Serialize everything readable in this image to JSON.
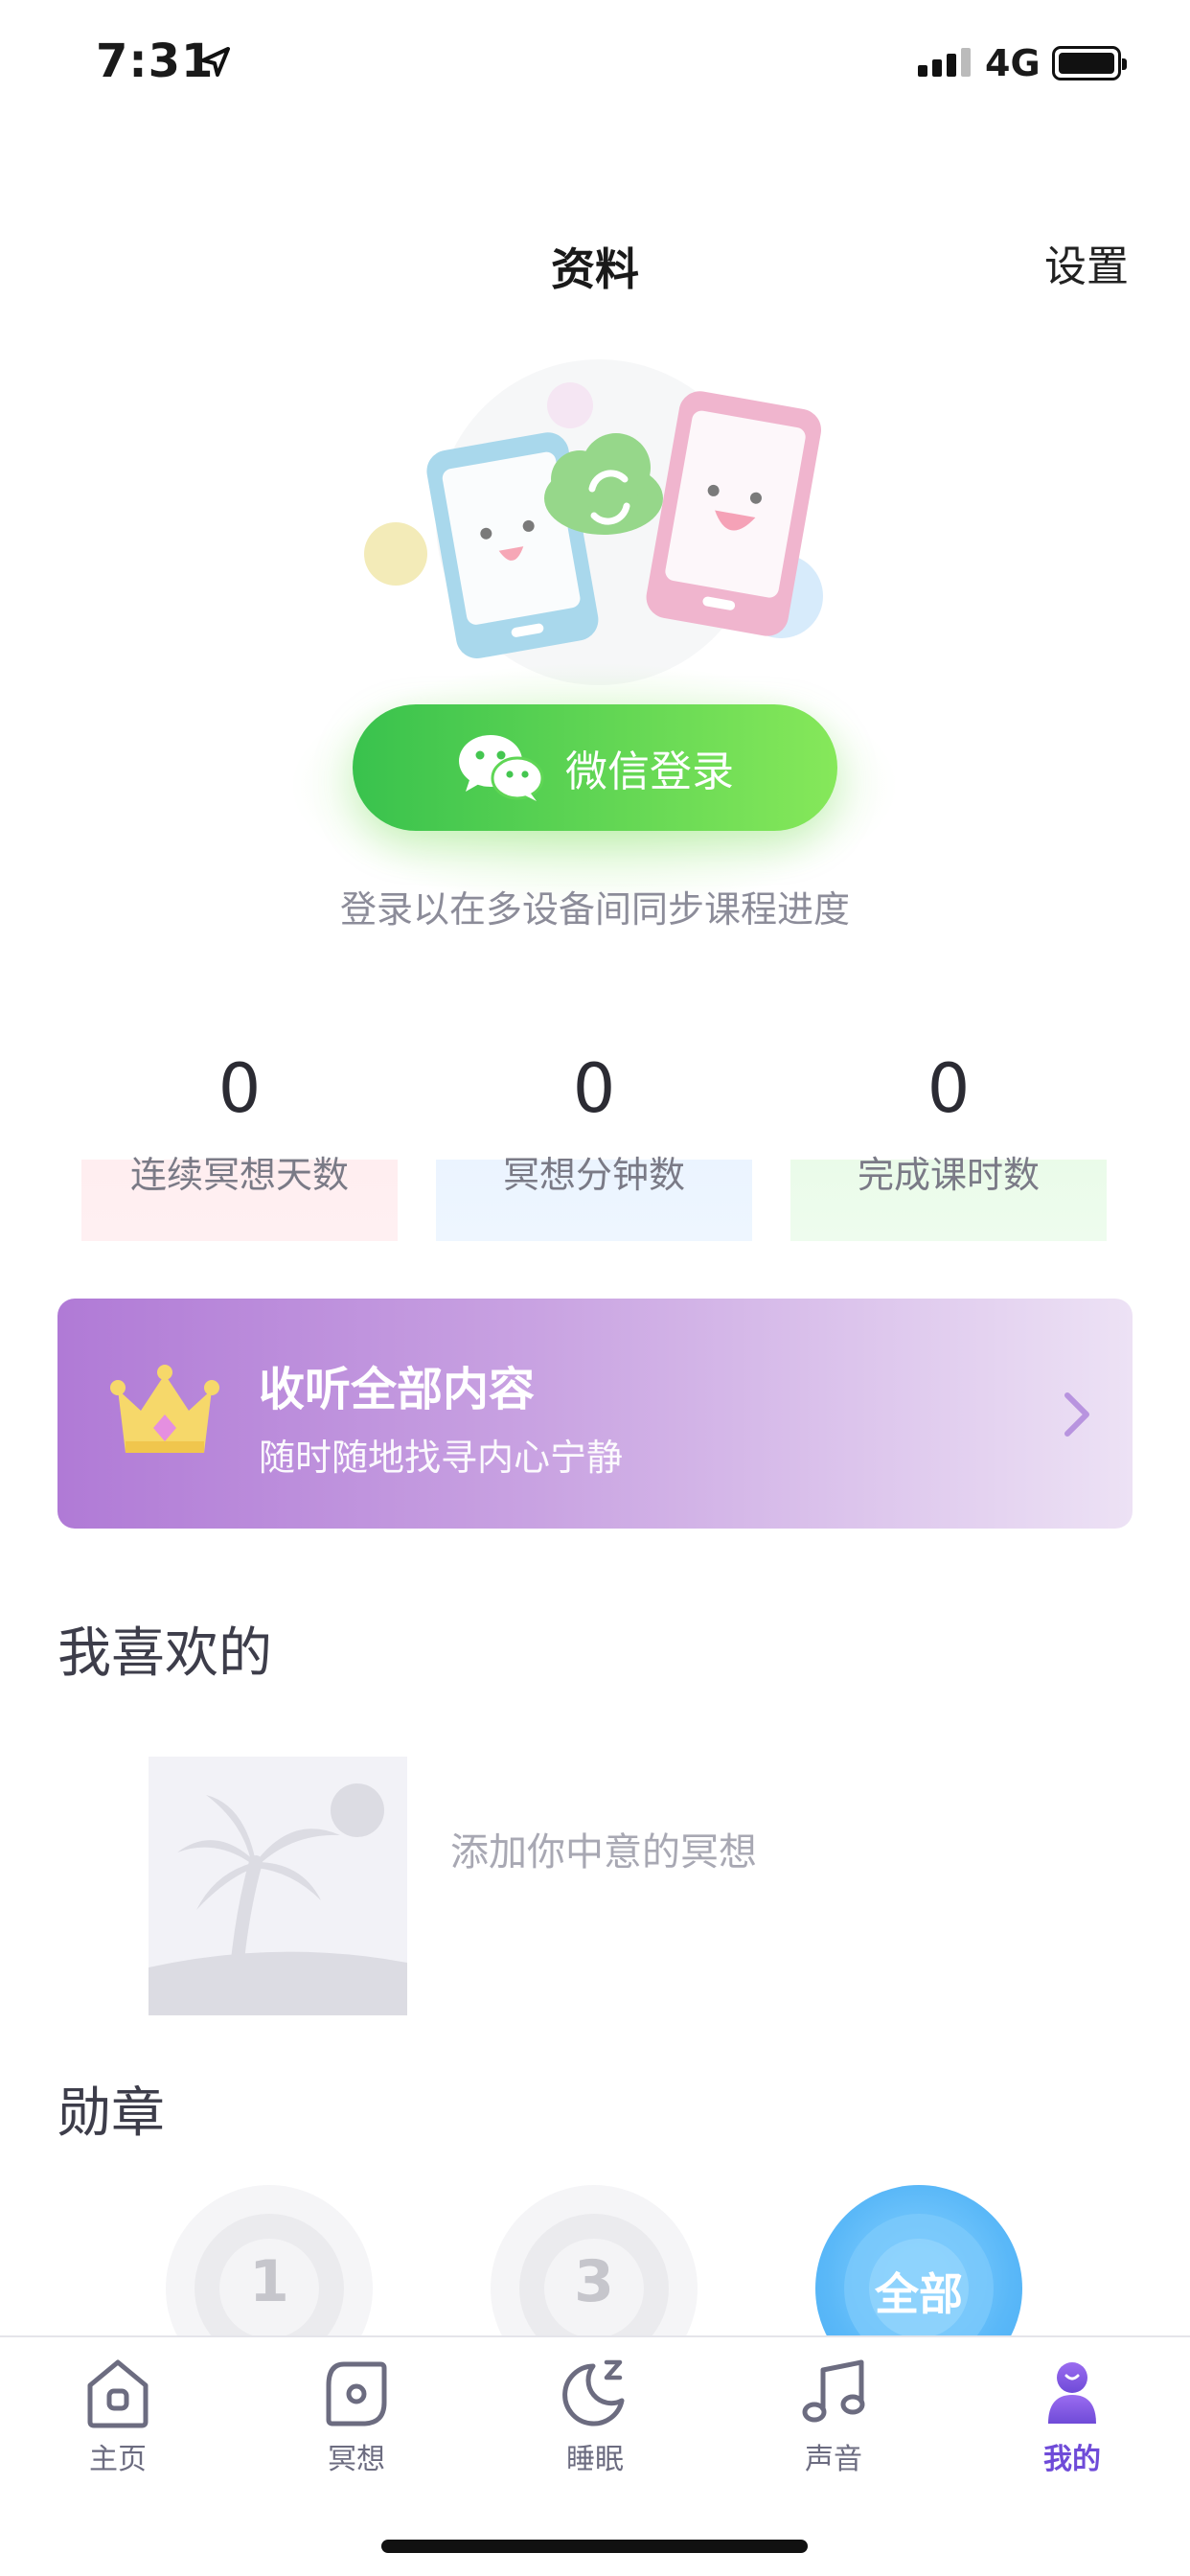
{
  "status_bar": {
    "time": "7:31",
    "network": "4G"
  },
  "header": {
    "title": "资料",
    "settings_label": "设置"
  },
  "login": {
    "button_label": "微信登录",
    "hint": "登录以在多设备间同步课程进度"
  },
  "stats": [
    {
      "value": "0",
      "label": "连续冥想天数",
      "color": "#ffe6e9"
    },
    {
      "value": "0",
      "label": "冥想分钟数",
      "color": "#e3efff"
    },
    {
      "value": "0",
      "label": "完成课时数",
      "color": "#e2f8e2"
    }
  ],
  "premium": {
    "title": "收听全部内容",
    "subtitle": "随时随地找寻内心宁静"
  },
  "favorites": {
    "title": "我喜欢的",
    "empty_text": "添加你中意的冥想"
  },
  "badges": {
    "title": "勋章",
    "items": [
      "1",
      "3",
      "全部"
    ]
  },
  "tabs": [
    {
      "label": "主页",
      "icon": "home-icon"
    },
    {
      "label": "冥想",
      "icon": "meditate-icon"
    },
    {
      "label": "睡眠",
      "icon": "moon-icon"
    },
    {
      "label": "声音",
      "icon": "music-icon"
    },
    {
      "label": "我的",
      "icon": "profile-icon",
      "active": true
    }
  ],
  "colors": {
    "accent": "#6f4bd8",
    "wechat_green": "#39c24d",
    "premium_purple": "#b07ad6"
  }
}
